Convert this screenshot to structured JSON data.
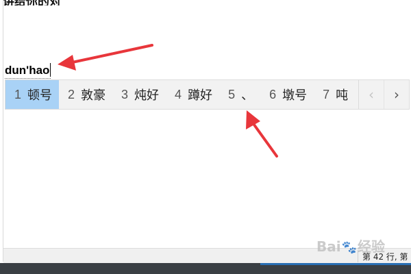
{
  "top_text": "讲给你的对",
  "composition": {
    "text": "dun'hao"
  },
  "candidates": [
    {
      "num": "1",
      "text": "顿号",
      "selected": true
    },
    {
      "num": "2",
      "text": "敦豪"
    },
    {
      "num": "3",
      "text": "炖好"
    },
    {
      "num": "4",
      "text": "蹲好"
    },
    {
      "num": "5",
      "text": "、"
    },
    {
      "num": "6",
      "text": "墩号"
    },
    {
      "num": "7",
      "text": "吨"
    }
  ],
  "nav": {
    "prev_icon": "chevron-left-icon",
    "next_icon": "chevron-right-icon",
    "prev": "‹",
    "next": "›"
  },
  "status": {
    "position": "第 42 行, 第"
  },
  "watermark": {
    "text_a": "Bai",
    "paw": "🐾",
    "text_b": "经验"
  },
  "colors": {
    "selected_candidate": "#a9d2f6",
    "annotation_arrow": "#e8363b"
  }
}
